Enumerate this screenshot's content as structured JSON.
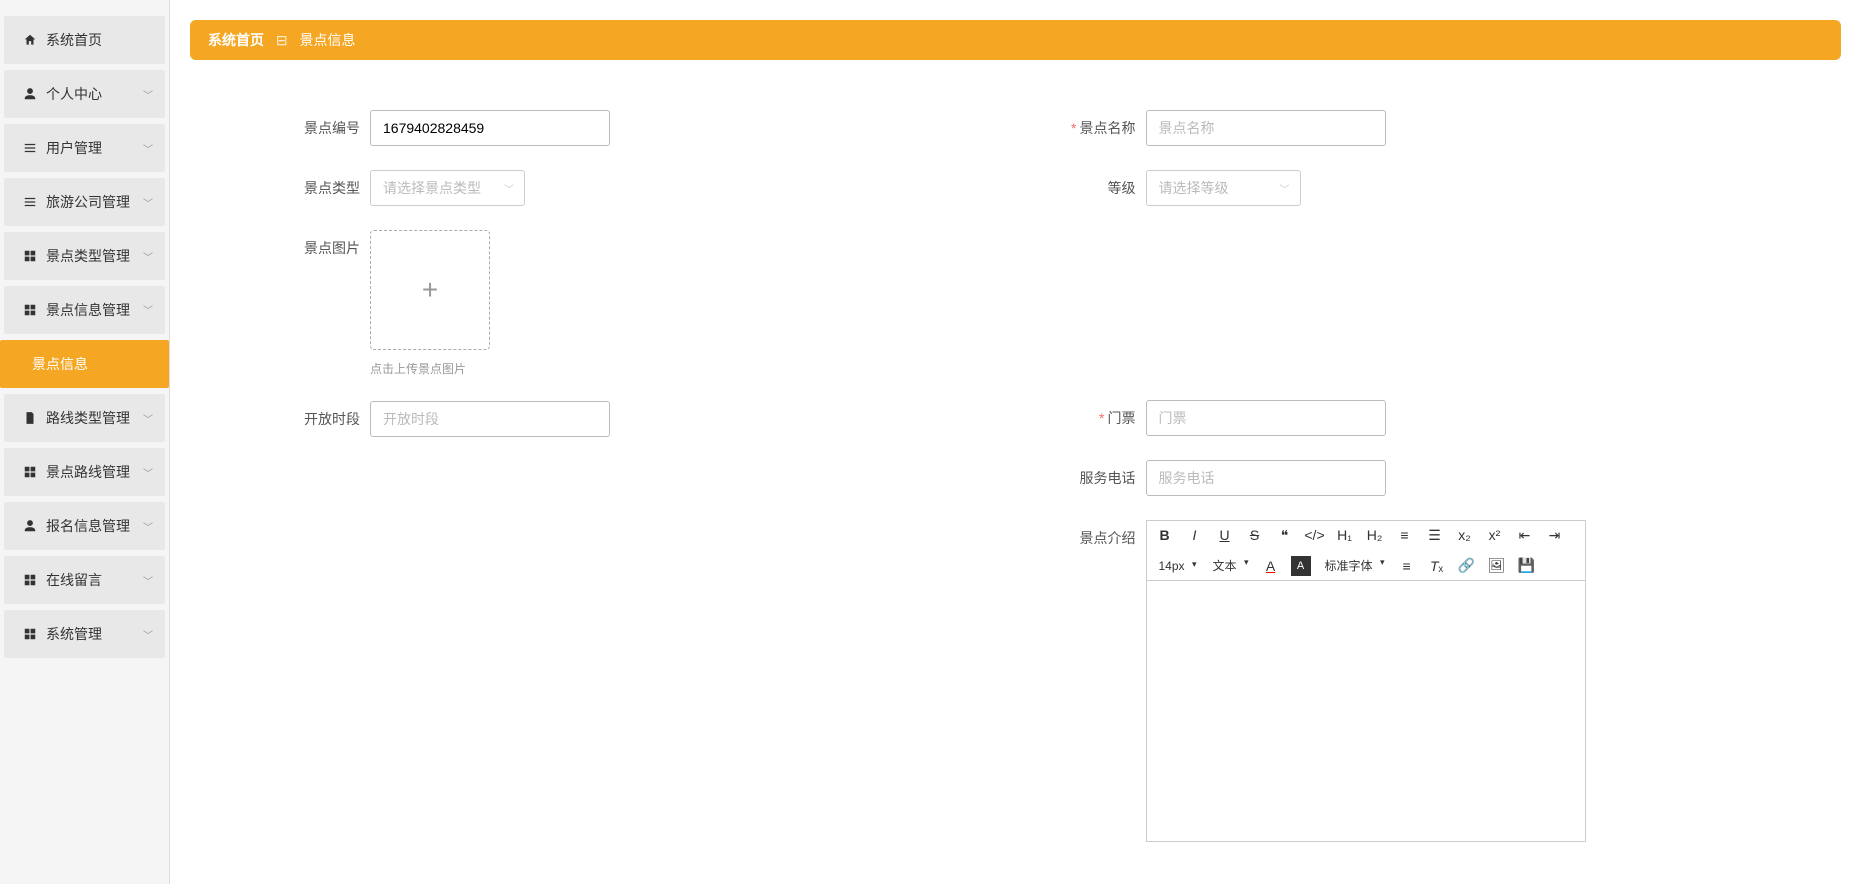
{
  "sidebar": {
    "items": [
      {
        "icon": "home",
        "label": "系统首页",
        "caret": false
      },
      {
        "icon": "user",
        "label": "个人中心",
        "caret": true
      },
      {
        "icon": "list",
        "label": "用户管理",
        "caret": true
      },
      {
        "icon": "list",
        "label": "旅游公司管理",
        "caret": true
      },
      {
        "icon": "grid",
        "label": "景点类型管理",
        "caret": true
      },
      {
        "icon": "grid",
        "label": "景点信息管理",
        "caret": true,
        "expanded": true
      },
      {
        "icon": "",
        "label": "景点信息",
        "active": true
      },
      {
        "icon": "doc",
        "label": "路线类型管理",
        "caret": true
      },
      {
        "icon": "grid",
        "label": "景点路线管理",
        "caret": true
      },
      {
        "icon": "user",
        "label": "报名信息管理",
        "caret": true
      },
      {
        "icon": "grid",
        "label": "在线留言",
        "caret": true
      },
      {
        "icon": "grid",
        "label": "系统管理",
        "caret": true
      }
    ]
  },
  "breadcrumb": {
    "home": "系统首页",
    "sep": "⊟",
    "current": "景点信息"
  },
  "form": {
    "spot_id_label": "景点编号",
    "spot_id_value": "1679402828459",
    "spot_type_label": "景点类型",
    "spot_type_placeholder": "请选择景点类型",
    "spot_image_label": "景点图片",
    "upload_hint": "点击上传景点图片",
    "open_time_label": "开放时段",
    "open_time_placeholder": "开放时段",
    "spot_name_label": "景点名称",
    "spot_name_placeholder": "景点名称",
    "level_label": "等级",
    "level_placeholder": "请选择等级",
    "ticket_label": "门票",
    "ticket_placeholder": "门票",
    "phone_label": "服务电话",
    "phone_placeholder": "服务电话",
    "intro_label": "景点介绍"
  },
  "editor": {
    "font_size": "14px",
    "format": "文本",
    "font_family": "标准字体"
  }
}
